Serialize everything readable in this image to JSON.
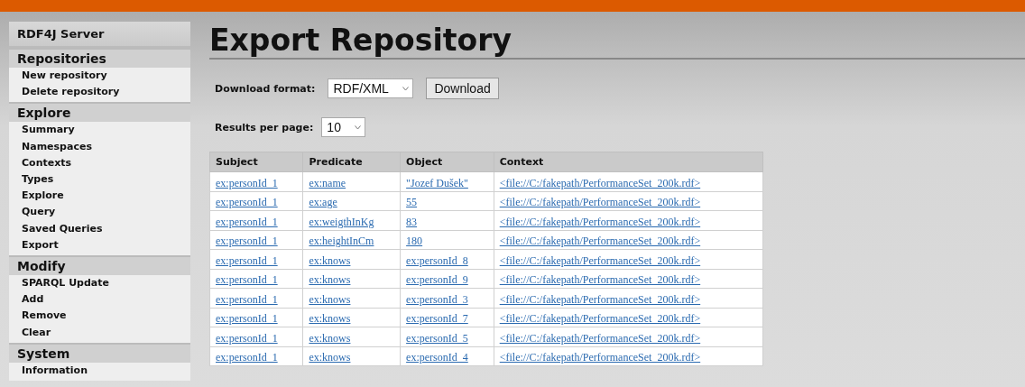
{
  "sidebar": {
    "title": "RDF4J Server",
    "sections": [
      {
        "heading": "Repositories",
        "items": [
          "New repository",
          "Delete repository"
        ]
      },
      {
        "heading": "Explore",
        "items": [
          "Summary",
          "Namespaces",
          "Contexts",
          "Types",
          "Explore",
          "Query",
          "Saved Queries",
          "Export"
        ]
      },
      {
        "heading": "Modify",
        "items": [
          "SPARQL Update",
          "Add",
          "Remove",
          "Clear"
        ]
      },
      {
        "heading": "System",
        "items": [
          "Information"
        ]
      }
    ]
  },
  "page_title": "Export Repository",
  "download_format": {
    "label": "Download format:",
    "value": "RDF/XML",
    "button": "Download"
  },
  "results_per_page": {
    "label": "Results per page:",
    "value": "10"
  },
  "table": {
    "columns": [
      "Subject",
      "Predicate",
      "Object",
      "Context"
    ],
    "rows": [
      [
        "ex:personId_1",
        "ex:name",
        "\"Jozef Dušek\"",
        "<file://C:/fakepath/PerformanceSet_200k.rdf>"
      ],
      [
        "ex:personId_1",
        "ex:age",
        "55",
        "<file://C:/fakepath/PerformanceSet_200k.rdf>"
      ],
      [
        "ex:personId_1",
        "ex:weigthInKg",
        "83",
        "<file://C:/fakepath/PerformanceSet_200k.rdf>"
      ],
      [
        "ex:personId_1",
        "ex:heightInCm",
        "180",
        "<file://C:/fakepath/PerformanceSet_200k.rdf>"
      ],
      [
        "ex:personId_1",
        "ex:knows",
        "ex:personId_8",
        "<file://C:/fakepath/PerformanceSet_200k.rdf>"
      ],
      [
        "ex:personId_1",
        "ex:knows",
        "ex:personId_9",
        "<file://C:/fakepath/PerformanceSet_200k.rdf>"
      ],
      [
        "ex:personId_1",
        "ex:knows",
        "ex:personId_3",
        "<file://C:/fakepath/PerformanceSet_200k.rdf>"
      ],
      [
        "ex:personId_1",
        "ex:knows",
        "ex:personId_7",
        "<file://C:/fakepath/PerformanceSet_200k.rdf>"
      ],
      [
        "ex:personId_1",
        "ex:knows",
        "ex:personId_5",
        "<file://C:/fakepath/PerformanceSet_200k.rdf>"
      ],
      [
        "ex:personId_1",
        "ex:knows",
        "ex:personId_4",
        "<file://C:/fakepath/PerformanceSet_200k.rdf>"
      ]
    ]
  }
}
